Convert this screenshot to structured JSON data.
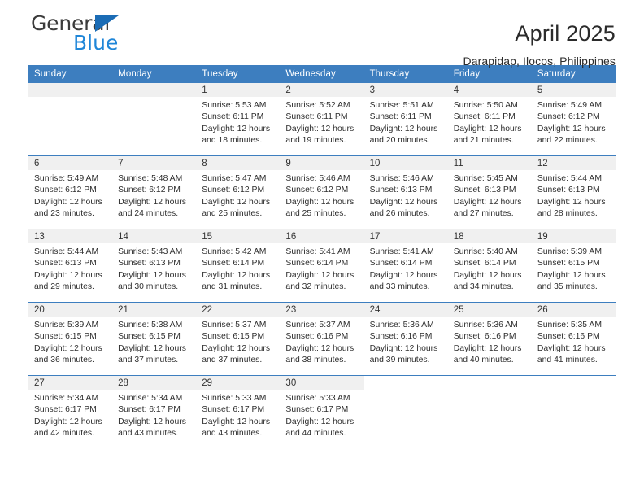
{
  "brand": {
    "name_top": "General",
    "name_bottom": "Blue",
    "accent_color": "#1f86d8",
    "triangle_color": "#1b6cb5"
  },
  "header": {
    "title": "April 2025",
    "subtitle": "Darapidap, Ilocos, Philippines"
  },
  "calendar": {
    "header_bg": "#3d7ebf",
    "daynum_bg": "#f0f0f0",
    "weekday_headers": [
      "Sunday",
      "Monday",
      "Tuesday",
      "Wednesday",
      "Thursday",
      "Friday",
      "Saturday"
    ],
    "weeks": [
      [
        {
          "day": "",
          "state": "empty",
          "lines": []
        },
        {
          "day": "",
          "state": "empty",
          "lines": []
        },
        {
          "day": "1",
          "state": "filled",
          "lines": [
            "Sunrise: 5:53 AM",
            "Sunset: 6:11 PM",
            "Daylight: 12 hours",
            "and 18 minutes."
          ]
        },
        {
          "day": "2",
          "state": "filled",
          "lines": [
            "Sunrise: 5:52 AM",
            "Sunset: 6:11 PM",
            "Daylight: 12 hours",
            "and 19 minutes."
          ]
        },
        {
          "day": "3",
          "state": "filled",
          "lines": [
            "Sunrise: 5:51 AM",
            "Sunset: 6:11 PM",
            "Daylight: 12 hours",
            "and 20 minutes."
          ]
        },
        {
          "day": "4",
          "state": "filled",
          "lines": [
            "Sunrise: 5:50 AM",
            "Sunset: 6:11 PM",
            "Daylight: 12 hours",
            "and 21 minutes."
          ]
        },
        {
          "day": "5",
          "state": "filled",
          "lines": [
            "Sunrise: 5:49 AM",
            "Sunset: 6:12 PM",
            "Daylight: 12 hours",
            "and 22 minutes."
          ]
        }
      ],
      [
        {
          "day": "6",
          "state": "filled",
          "lines": [
            "Sunrise: 5:49 AM",
            "Sunset: 6:12 PM",
            "Daylight: 12 hours",
            "and 23 minutes."
          ]
        },
        {
          "day": "7",
          "state": "filled",
          "lines": [
            "Sunrise: 5:48 AM",
            "Sunset: 6:12 PM",
            "Daylight: 12 hours",
            "and 24 minutes."
          ]
        },
        {
          "day": "8",
          "state": "filled",
          "lines": [
            "Sunrise: 5:47 AM",
            "Sunset: 6:12 PM",
            "Daylight: 12 hours",
            "and 25 minutes."
          ]
        },
        {
          "day": "9",
          "state": "filled",
          "lines": [
            "Sunrise: 5:46 AM",
            "Sunset: 6:12 PM",
            "Daylight: 12 hours",
            "and 25 minutes."
          ]
        },
        {
          "day": "10",
          "state": "filled",
          "lines": [
            "Sunrise: 5:46 AM",
            "Sunset: 6:13 PM",
            "Daylight: 12 hours",
            "and 26 minutes."
          ]
        },
        {
          "day": "11",
          "state": "filled",
          "lines": [
            "Sunrise: 5:45 AM",
            "Sunset: 6:13 PM",
            "Daylight: 12 hours",
            "and 27 minutes."
          ]
        },
        {
          "day": "12",
          "state": "filled",
          "lines": [
            "Sunrise: 5:44 AM",
            "Sunset: 6:13 PM",
            "Daylight: 12 hours",
            "and 28 minutes."
          ]
        }
      ],
      [
        {
          "day": "13",
          "state": "filled",
          "lines": [
            "Sunrise: 5:44 AM",
            "Sunset: 6:13 PM",
            "Daylight: 12 hours",
            "and 29 minutes."
          ]
        },
        {
          "day": "14",
          "state": "filled",
          "lines": [
            "Sunrise: 5:43 AM",
            "Sunset: 6:13 PM",
            "Daylight: 12 hours",
            "and 30 minutes."
          ]
        },
        {
          "day": "15",
          "state": "filled",
          "lines": [
            "Sunrise: 5:42 AM",
            "Sunset: 6:14 PM",
            "Daylight: 12 hours",
            "and 31 minutes."
          ]
        },
        {
          "day": "16",
          "state": "filled",
          "lines": [
            "Sunrise: 5:41 AM",
            "Sunset: 6:14 PM",
            "Daylight: 12 hours",
            "and 32 minutes."
          ]
        },
        {
          "day": "17",
          "state": "filled",
          "lines": [
            "Sunrise: 5:41 AM",
            "Sunset: 6:14 PM",
            "Daylight: 12 hours",
            "and 33 minutes."
          ]
        },
        {
          "day": "18",
          "state": "filled",
          "lines": [
            "Sunrise: 5:40 AM",
            "Sunset: 6:14 PM",
            "Daylight: 12 hours",
            "and 34 minutes."
          ]
        },
        {
          "day": "19",
          "state": "filled",
          "lines": [
            "Sunrise: 5:39 AM",
            "Sunset: 6:15 PM",
            "Daylight: 12 hours",
            "and 35 minutes."
          ]
        }
      ],
      [
        {
          "day": "20",
          "state": "filled",
          "lines": [
            "Sunrise: 5:39 AM",
            "Sunset: 6:15 PM",
            "Daylight: 12 hours",
            "and 36 minutes."
          ]
        },
        {
          "day": "21",
          "state": "filled",
          "lines": [
            "Sunrise: 5:38 AM",
            "Sunset: 6:15 PM",
            "Daylight: 12 hours",
            "and 37 minutes."
          ]
        },
        {
          "day": "22",
          "state": "filled",
          "lines": [
            "Sunrise: 5:37 AM",
            "Sunset: 6:15 PM",
            "Daylight: 12 hours",
            "and 37 minutes."
          ]
        },
        {
          "day": "23",
          "state": "filled",
          "lines": [
            "Sunrise: 5:37 AM",
            "Sunset: 6:16 PM",
            "Daylight: 12 hours",
            "and 38 minutes."
          ]
        },
        {
          "day": "24",
          "state": "filled",
          "lines": [
            "Sunrise: 5:36 AM",
            "Sunset: 6:16 PM",
            "Daylight: 12 hours",
            "and 39 minutes."
          ]
        },
        {
          "day": "25",
          "state": "filled",
          "lines": [
            "Sunrise: 5:36 AM",
            "Sunset: 6:16 PM",
            "Daylight: 12 hours",
            "and 40 minutes."
          ]
        },
        {
          "day": "26",
          "state": "filled",
          "lines": [
            "Sunrise: 5:35 AM",
            "Sunset: 6:16 PM",
            "Daylight: 12 hours",
            "and 41 minutes."
          ]
        }
      ],
      [
        {
          "day": "27",
          "state": "filled",
          "lines": [
            "Sunrise: 5:34 AM",
            "Sunset: 6:17 PM",
            "Daylight: 12 hours",
            "and 42 minutes."
          ]
        },
        {
          "day": "28",
          "state": "filled",
          "lines": [
            "Sunrise: 5:34 AM",
            "Sunset: 6:17 PM",
            "Daylight: 12 hours",
            "and 43 minutes."
          ]
        },
        {
          "day": "29",
          "state": "filled",
          "lines": [
            "Sunrise: 5:33 AM",
            "Sunset: 6:17 PM",
            "Daylight: 12 hours",
            "and 43 minutes."
          ]
        },
        {
          "day": "30",
          "state": "filled",
          "lines": [
            "Sunrise: 5:33 AM",
            "Sunset: 6:17 PM",
            "Daylight: 12 hours",
            "and 44 minutes."
          ]
        },
        {
          "day": "",
          "state": "blank",
          "lines": []
        },
        {
          "day": "",
          "state": "blank",
          "lines": []
        },
        {
          "day": "",
          "state": "blank",
          "lines": []
        }
      ]
    ]
  }
}
